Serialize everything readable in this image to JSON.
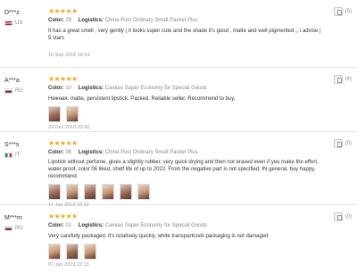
{
  "reviews": [
    {
      "user": "D***z",
      "country": "US",
      "flag": "us",
      "stars": 5,
      "color_label": "Color:",
      "color": "29",
      "logistics_label": "Logistics:",
      "logistics": "China Post Ordinary Small Packet Plus",
      "text": "It has a great smell , very gently ( it looks super cute and the shade it's good , matte and well pigmented ,, i advise | 5 stars",
      "photos": 0,
      "date": "10 Sep 2018 18:04",
      "helpful": "(5)"
    },
    {
      "user": "A***a",
      "country": "RU",
      "flag": "ru",
      "stars": 5,
      "color_label": "Color:",
      "color": "10",
      "logistics_label": "Logistics:",
      "logistics": "Cainiao Super Economy for Special Goods",
      "text": "Нежная, matte, persistent lipstick. Packed. Reliable seller. Recommend to buy.",
      "photos": 2,
      "date": "24 Dec 2018 03:42",
      "helpful": "(4)"
    },
    {
      "user": "S***s",
      "country": "IT",
      "flag": "it",
      "stars": 5,
      "color_label": "Color:",
      "color": "06",
      "logistics_label": "Logistics:",
      "logistics": "China Post Ordinary Small Packet Plus",
      "text": "Lipstick without perfume, gives a slightly rubber, very quick drying and then not erased even if you make the effort, water-proof, color 06 liked, shelf life of up to 2022. From the negative part is not specified. IN general, buy happy, recommend.",
      "photos": 6,
      "date": "17 Jan 2019 10:13",
      "helpful": "(0)"
    },
    {
      "user": "M***m",
      "country": "RU",
      "flag": "ru",
      "stars": 5,
      "color_label": "Color:",
      "color": "01",
      "logistics_label": "Logistics:",
      "logistics": "Cainiao Super Economy for Special Goods",
      "text": "Very carefully packaged. It's relatively quickly, white transpartrovki packaging is not damaged",
      "photos": 3,
      "date": "07 Jan 2019 22:13",
      "helpful": "(0)"
    }
  ],
  "star_glyph": "★",
  "colors": {
    "star": "#f5a623"
  }
}
